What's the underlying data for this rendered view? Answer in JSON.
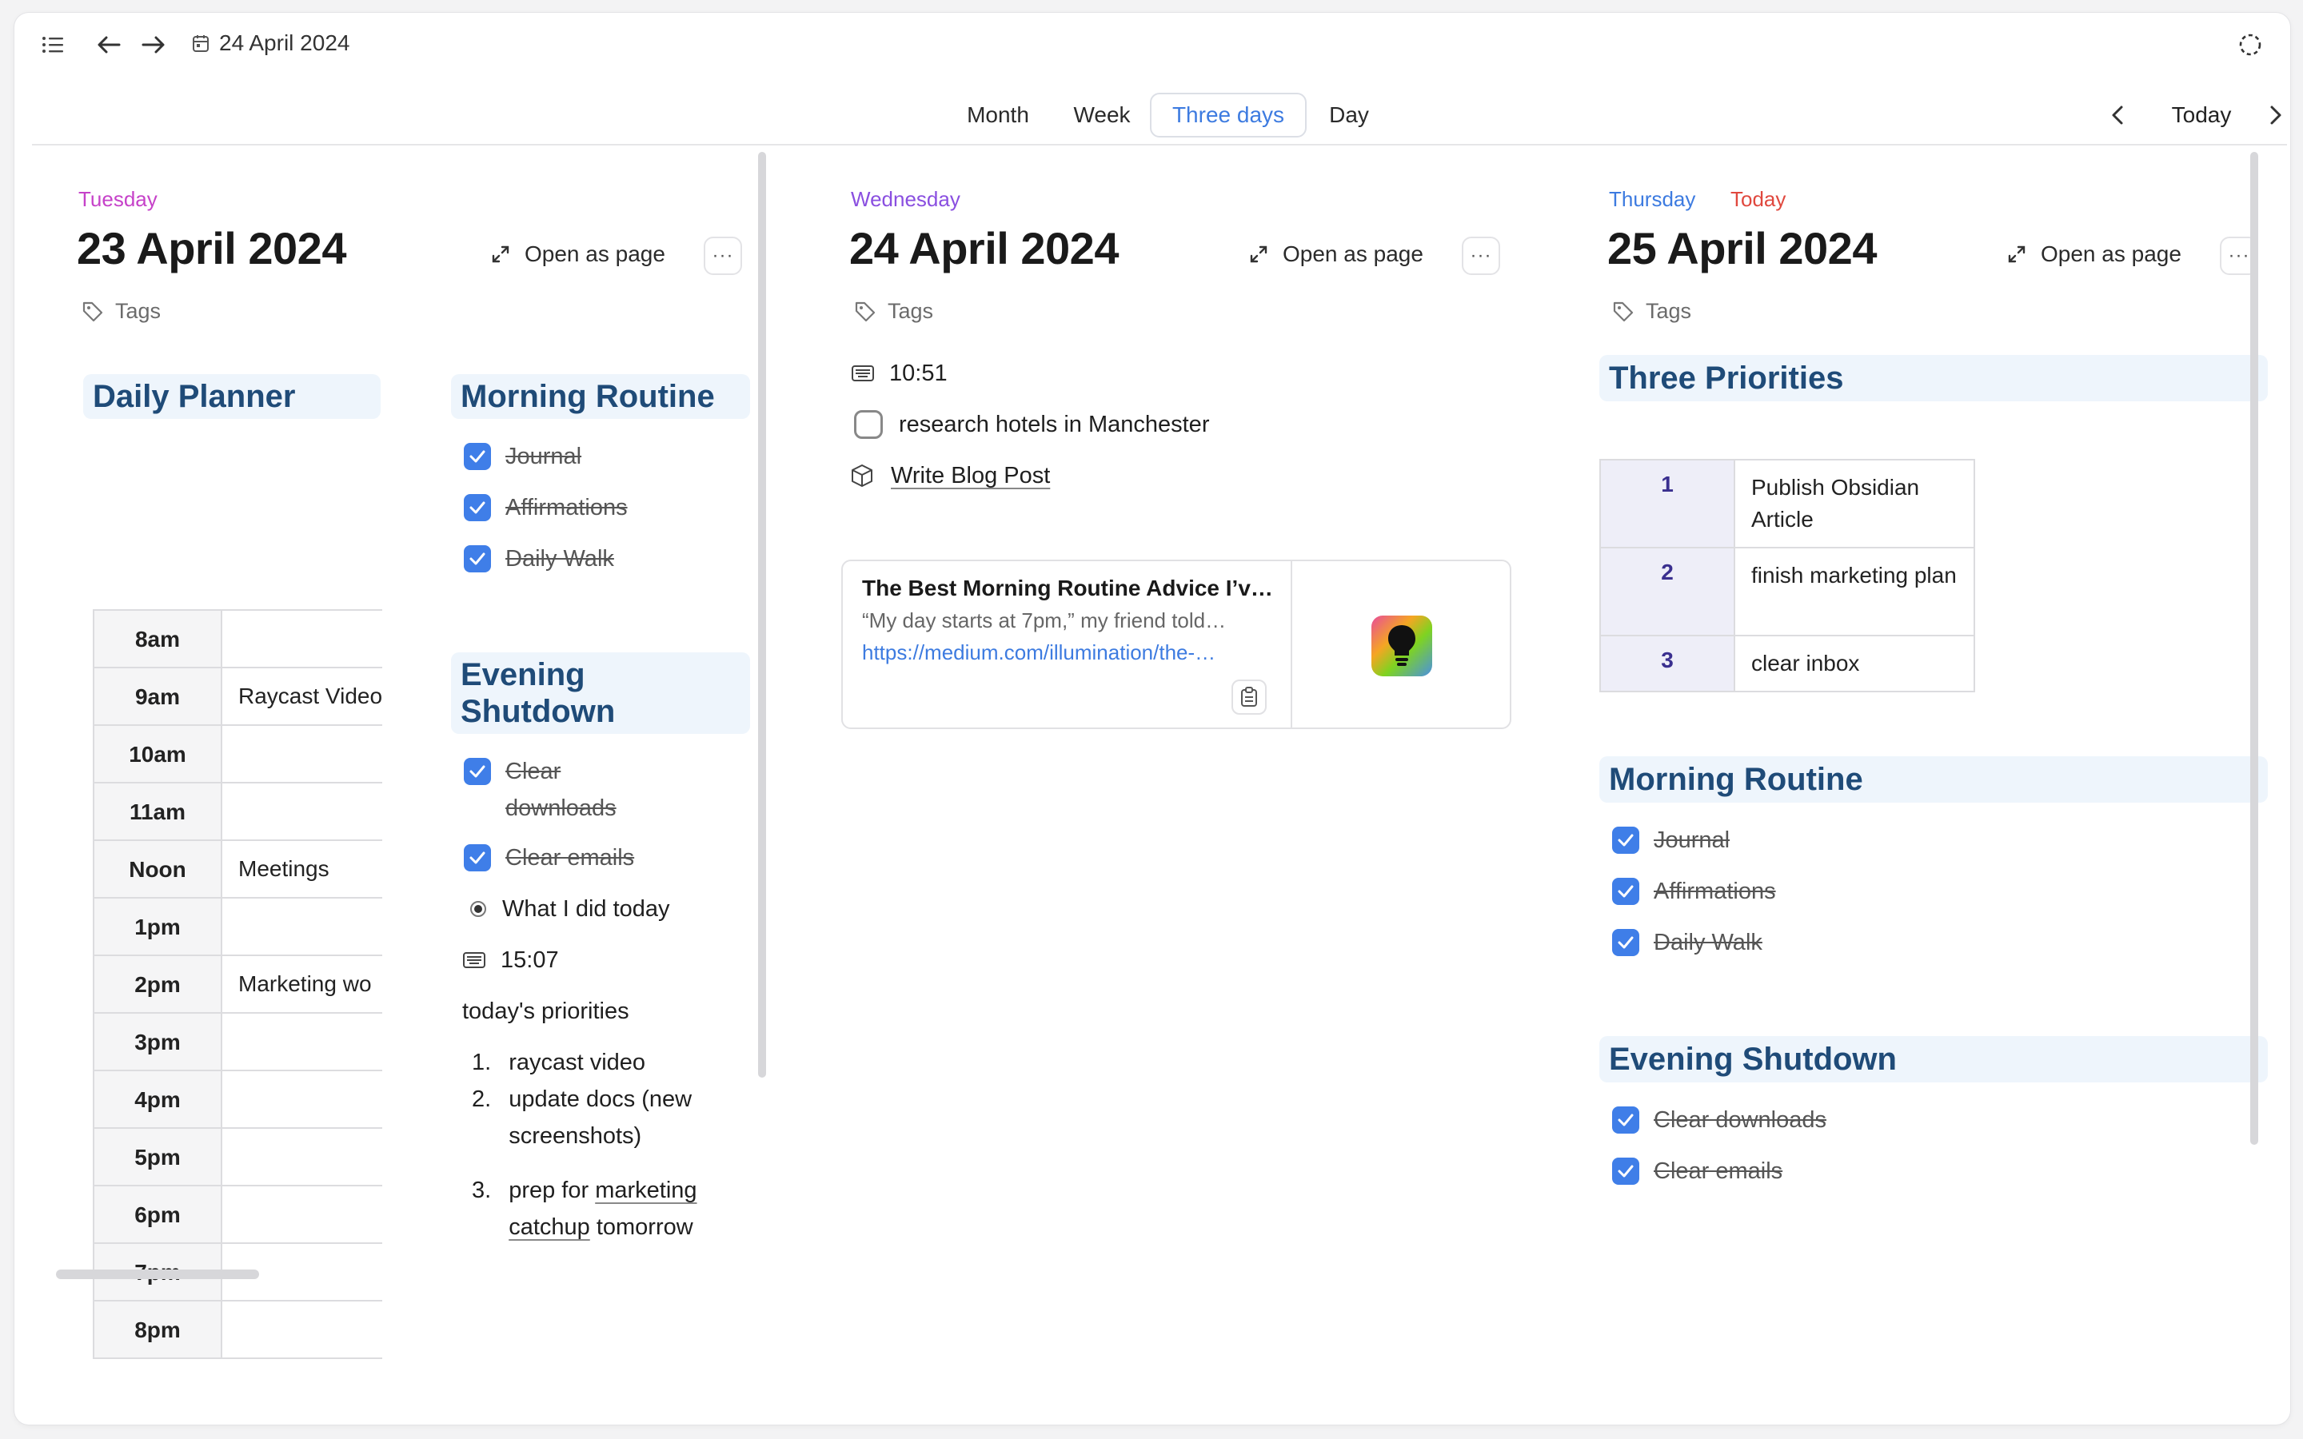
{
  "header": {
    "date_crumb": "24 April 2024"
  },
  "views": {
    "month": "Month",
    "week": "Week",
    "three_days": "Three days",
    "day": "Day",
    "today": "Today"
  },
  "common": {
    "open_as_page": "Open as page",
    "more": "···",
    "tags": "Tags"
  },
  "day1": {
    "weekday": "Tuesday",
    "date": "23 April 2024",
    "planner_title": "Daily Planner",
    "planner": [
      {
        "time": "8am",
        "value": ""
      },
      {
        "time": "9am",
        "value": "Raycast Video"
      },
      {
        "time": "10am",
        "value": ""
      },
      {
        "time": "11am",
        "value": ""
      },
      {
        "time": "Noon",
        "value": "Meetings"
      },
      {
        "time": "1pm",
        "value": ""
      },
      {
        "time": "2pm",
        "value": "Marketing wo"
      },
      {
        "time": "3pm",
        "value": ""
      },
      {
        "time": "4pm",
        "value": ""
      },
      {
        "time": "5pm",
        "value": ""
      },
      {
        "time": "6pm",
        "value": ""
      },
      {
        "time": "7pm",
        "value": ""
      },
      {
        "time": "8pm",
        "value": ""
      }
    ],
    "morning_title": "Morning Routine",
    "morning": [
      "Journal",
      "Affirmations",
      "Daily Walk"
    ],
    "evening_title_1": "Evening",
    "evening_title_2": "Shutdown",
    "evening_1a": "Clear",
    "evening_1b": "downloads",
    "evening_2": "Clear emails",
    "what_i_did": "What I did today",
    "time_stamp": "15:07",
    "priorities_label": "today's priorities",
    "list": {
      "n1": "1.",
      "i1": "raycast video",
      "n2": "2.",
      "i2a": "update docs (new",
      "i2b": "screenshots)",
      "n3": "3.",
      "i3a": "prep for",
      "i3link1": "marketing",
      "i3link2": "catchup",
      "i3rest": "tomorrow"
    }
  },
  "day2": {
    "weekday": "Wednesday",
    "date": "24 April 2024",
    "time_stamp": "10:51",
    "task": "research hotels in Manchester",
    "link_item": "Write Blog Post",
    "card": {
      "title": "The Best Morning Routine Advice I’ve…",
      "description": "“My day starts at 7pm,” my friend told…",
      "url": "https://medium.com/illumination/the-…"
    }
  },
  "day3": {
    "weekday": "Thursday",
    "today_badge": "Today",
    "date": "25 April 2024",
    "priorities_title": "Three Priorities",
    "priorities": [
      {
        "num": "1",
        "text": "Publish Obsidian Article"
      },
      {
        "num": "2",
        "text": "finish marketing plan"
      },
      {
        "num": "3",
        "text": "clear inbox"
      }
    ],
    "morning_title": "Morning Routine",
    "morning": [
      "Journal",
      "Affirmations",
      "Daily Walk"
    ],
    "evening_title": "Evening Shutdown",
    "evening": [
      "Clear downloads",
      "Clear emails"
    ]
  },
  "colors": {
    "accent": "#3d7be0",
    "tuesday": "#c642c9",
    "wednesday": "#8a4fe0",
    "thursday": "#3d7be0",
    "today": "#e0483e",
    "heading": "#1f4b78",
    "checkbox": "#3f7ee8"
  }
}
